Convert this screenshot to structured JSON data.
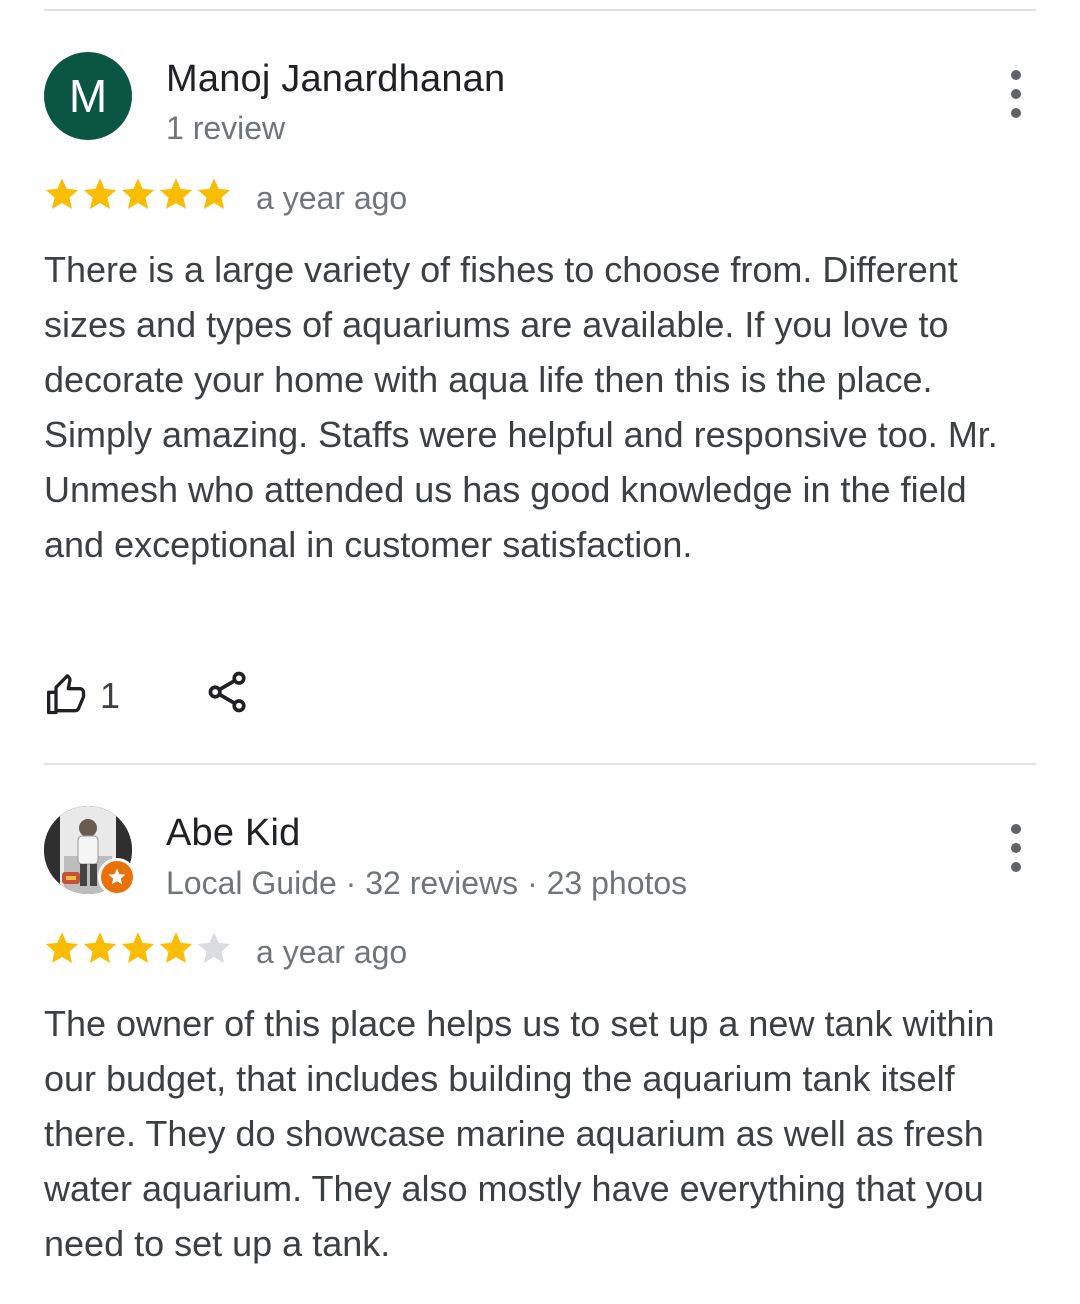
{
  "reviews": [
    {
      "avatar_letter": "M",
      "author": "Manoj Janardhanan",
      "meta": "1 review",
      "rating": 5,
      "time": "a year ago",
      "text": "There is a large variety of fishes to choose from. Different sizes and types of aquariums are available. If you love to decorate your home with aqua life then this is the place. Simply amazing. Staffs were helpful and responsive too. Mr. Unmesh who attended us has good knowledge in the field and  exceptional in customer satisfaction.",
      "likes": "1",
      "icons": [
        "thumbs-up-icon",
        "share-icon",
        "more-vert-icon"
      ]
    },
    {
      "author": "Abe Kid",
      "meta": "Local Guide · 32 reviews · 23 photos",
      "rating": 4,
      "time": "a year ago",
      "text": "The owner of this place helps us to set up a new tank within our budget, that includes building the aquarium tank itself there. They do showcase marine aquarium as well as fresh water aquarium. They also mostly have everything that you need to set up a tank.",
      "icons": [
        "local-guide-badge-icon",
        "more-vert-icon"
      ]
    }
  ],
  "colors": {
    "star_filled": "#fbbc04",
    "star_empty": "#dadce0",
    "avatar_bg": "#0a5642",
    "badge": "#e8710a"
  }
}
